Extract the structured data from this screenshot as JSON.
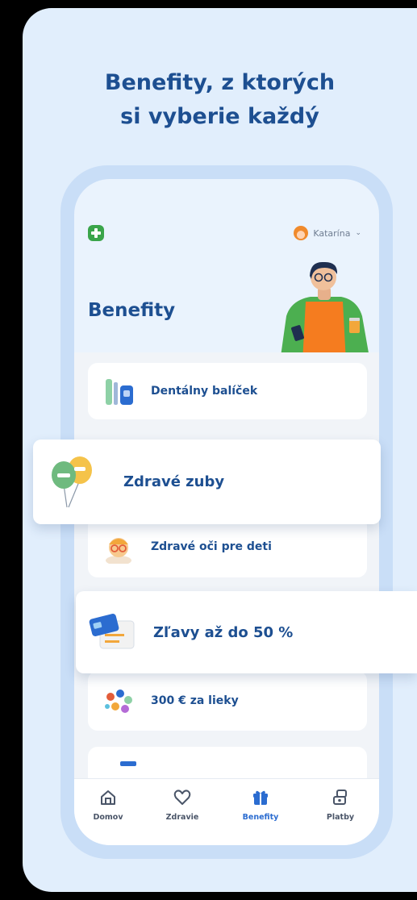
{
  "promo": {
    "headline_line1": "Benefity, z ktorých",
    "headline_line2": "si vyberie každý"
  },
  "app": {
    "user_name": "Katarína",
    "page_title": "Benefity"
  },
  "benefits": {
    "item1": "Dentálny balíček",
    "floating1": "Zdravé zuby",
    "item2": "Zdravé oči pre deti",
    "floating2": "Zľavy až do 50 %",
    "item3": "300 € za lieky"
  },
  "bottom_nav": {
    "home": "Domov",
    "health": "Zdravie",
    "benefits": "Benefity",
    "payments": "Platby"
  },
  "colors": {
    "brand_blue": "#1d4f91",
    "active_blue": "#2b6cd0",
    "brand_green": "#3aa54a",
    "background": "#e1eefc"
  }
}
